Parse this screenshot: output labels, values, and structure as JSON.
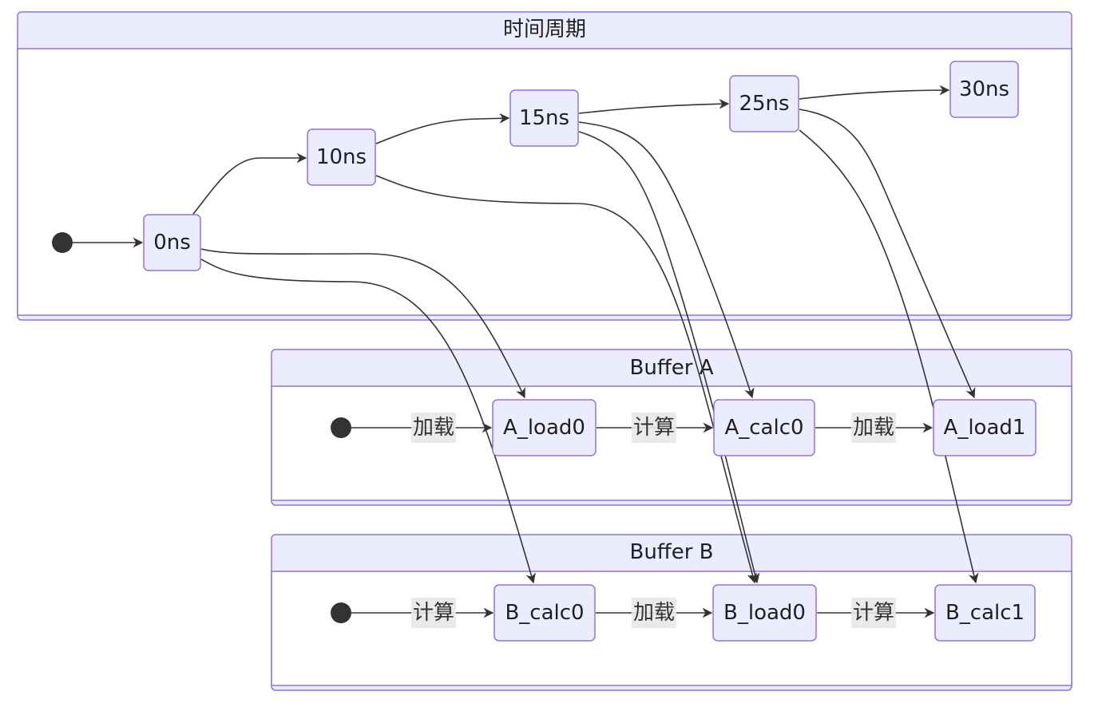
{
  "clusters": {
    "time": {
      "title": "时间周期"
    },
    "buffer_a": {
      "title": "Buffer A"
    },
    "buffer_b": {
      "title": "Buffer B"
    }
  },
  "nodes": {
    "t0": "0ns",
    "t10": "10ns",
    "t15": "15ns",
    "t25": "25ns",
    "t30": "30ns",
    "a_load0": "A_load0",
    "a_calc0": "A_calc0",
    "a_load1": "A_load1",
    "b_calc0": "B_calc0",
    "b_load0": "B_load0",
    "b_calc1": "B_calc1"
  },
  "edge_labels": {
    "a_start": "加载",
    "a_load0_calc0": "计算",
    "a_calc0_load1": "加载",
    "b_start": "计算",
    "b_calc0_load0": "加载",
    "b_load0_calc1": "计算"
  },
  "colors": {
    "node_fill": "#ececff",
    "node_stroke": "#9370db",
    "edge": "#333333",
    "label_bg": "#e8e8e8"
  }
}
